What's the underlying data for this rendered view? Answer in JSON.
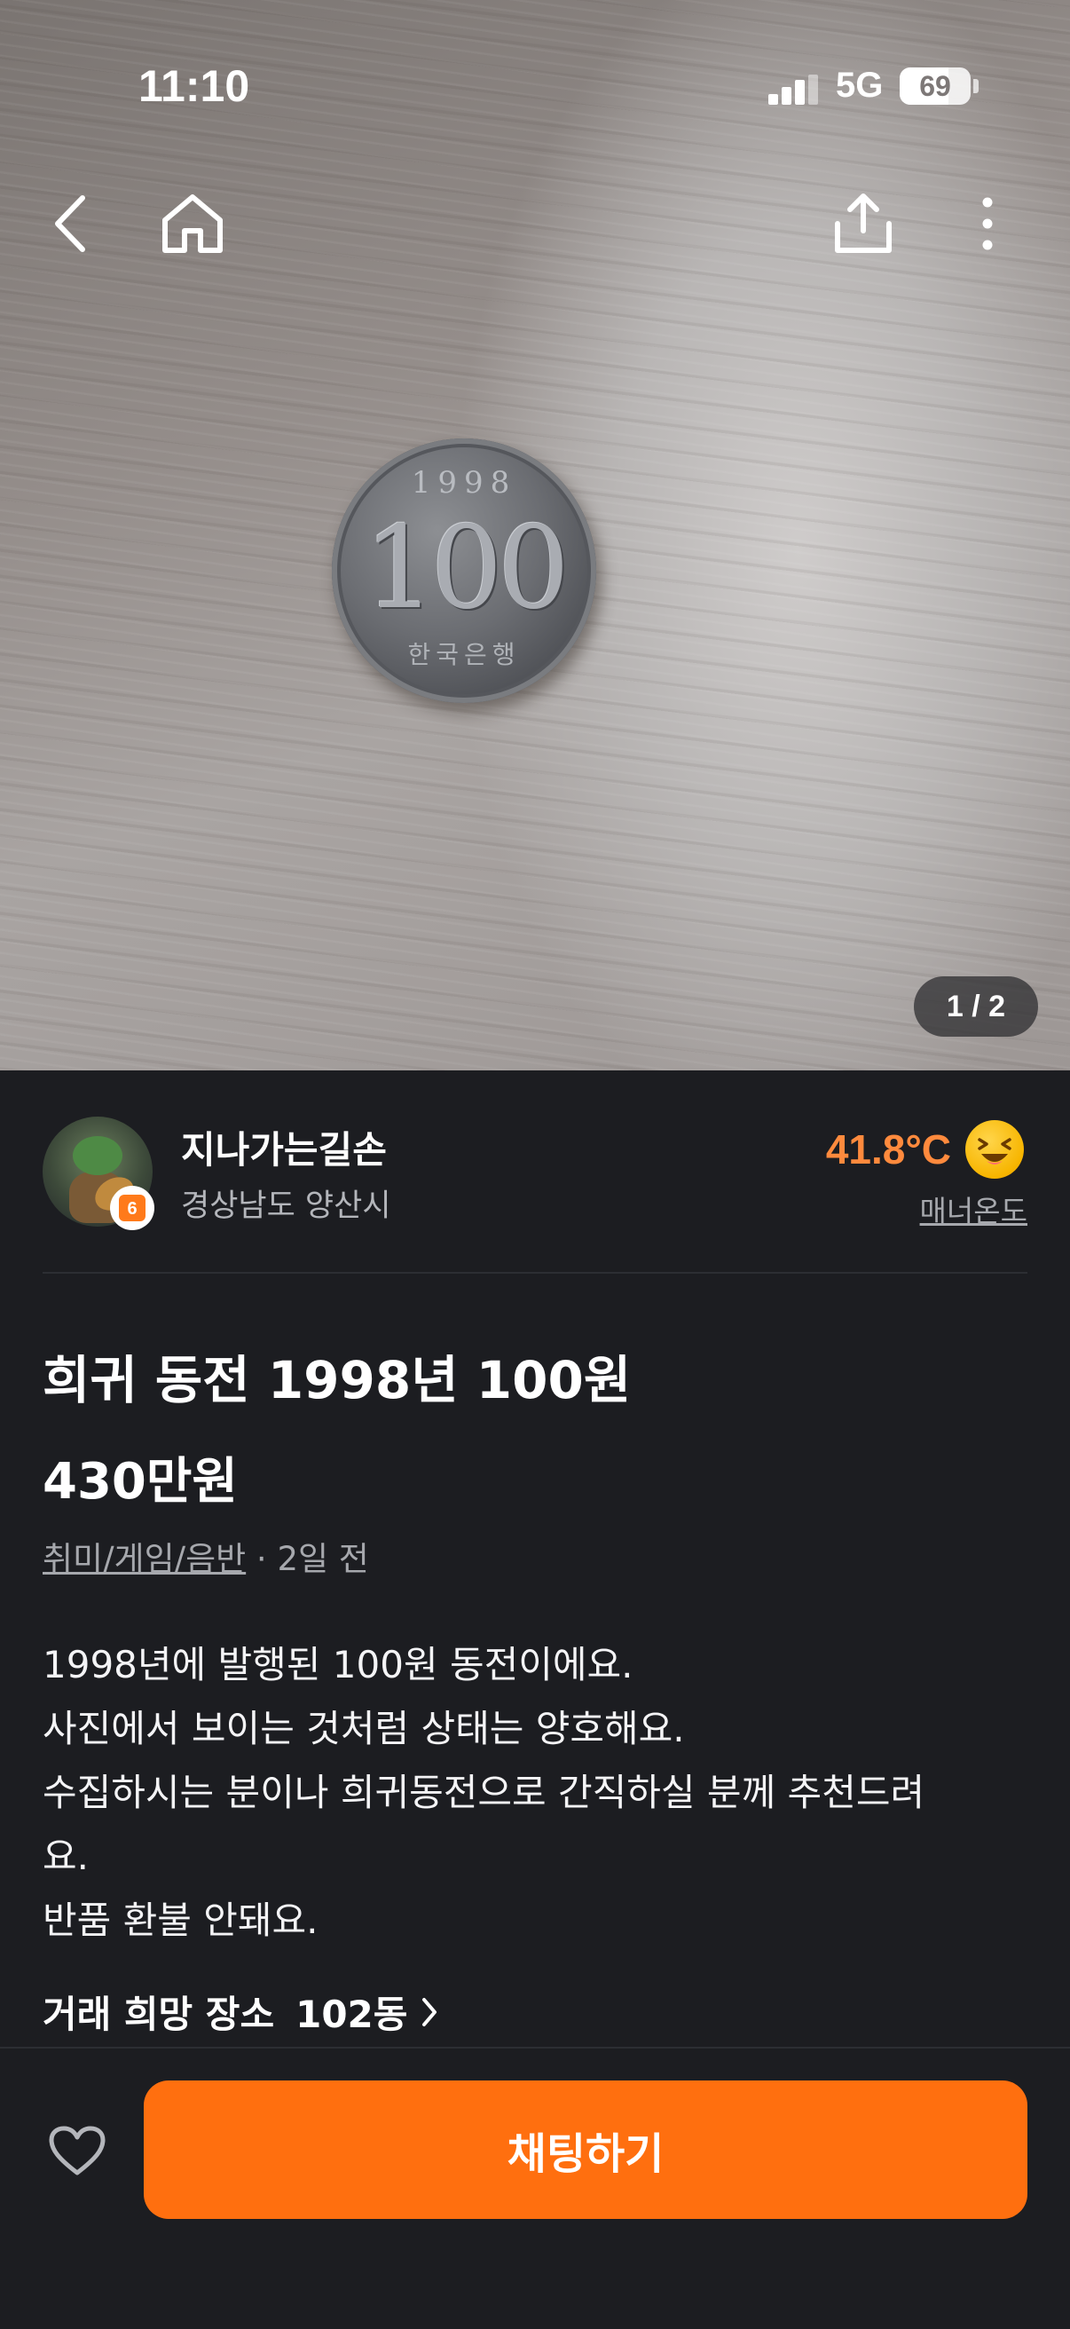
{
  "status_bar": {
    "time": "11:10",
    "network": "5G",
    "battery": "69",
    "battery_level": 0.69
  },
  "photo": {
    "counter": "1 / 2",
    "coin": {
      "year": "1998",
      "value": "100",
      "label": "한국은행"
    }
  },
  "icons": {
    "back": "chevron-left-icon",
    "home": "home-icon",
    "share": "share-icon",
    "more": "more-vertical-icon",
    "heart": "heart-outline-icon",
    "chevron": "chevron-right-icon"
  },
  "seller": {
    "nickname": "지나가는길손",
    "location": "경상남도 양산시",
    "temperature": "41.8°C",
    "manner_label": "매너온도"
  },
  "product": {
    "title": "희귀 동전 1998년 100원",
    "price": "430만원",
    "category": "취미/게임/음반",
    "time_ago": " · 2일 전",
    "description": [
      "1998년에 발행된 100원 동전이에요.",
      "사진에서 보이는 것처럼 상태는 양호해요.",
      "수집하시는 분이나 희귀동전으로 간직하실 분께 추천드려",
      "요.",
      "반품 환불 안돼요."
    ],
    "trade_place_label": "거래 희망 장소",
    "trade_place_value": "102동"
  },
  "actions": {
    "chat_label": "채팅하기"
  },
  "colors": {
    "accent": "#ff6f0f",
    "temperature": "#ff8a3d",
    "background": "#1c1d21"
  }
}
